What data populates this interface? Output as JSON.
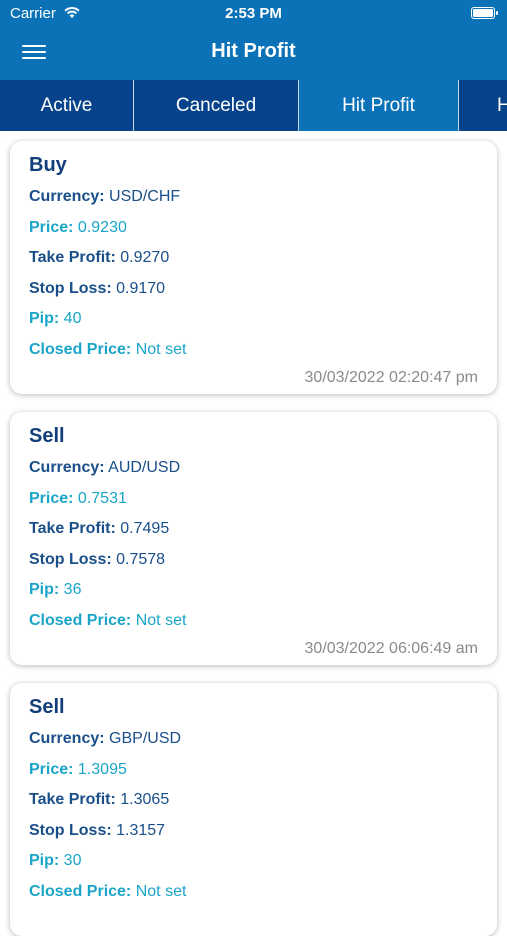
{
  "status_bar": {
    "carrier": "Carrier",
    "time": "2:53 PM"
  },
  "header": {
    "title": "Hit Profit"
  },
  "tabs": [
    {
      "label": "Active"
    },
    {
      "label": "Canceled"
    },
    {
      "label": "Hit Profit",
      "selected": true
    },
    {
      "label": "H"
    }
  ],
  "field_labels": {
    "currency": "Currency:",
    "price": "Price:",
    "take_profit": "Take Profit:",
    "stop_loss": "Stop Loss:",
    "pip": "Pip:",
    "closed_price": "Closed Price:"
  },
  "orders": [
    {
      "type": "Buy",
      "currency": "USD/CHF",
      "price": "0.9230",
      "take_profit": "0.9270",
      "stop_loss": "0.9170",
      "pip": "40",
      "closed_price": "Not set",
      "datetime": "30/03/2022 02:20:47 pm"
    },
    {
      "type": "Sell",
      "currency": "AUD/USD",
      "price": "0.7531",
      "take_profit": "0.7495",
      "stop_loss": "0.7578",
      "pip": "36",
      "closed_price": "Not set",
      "datetime": "30/03/2022 06:06:49 am"
    },
    {
      "type": "Sell",
      "currency": "GBP/USD",
      "price": "1.3095",
      "take_profit": "1.3065",
      "stop_loss": "1.3157",
      "pip": "30",
      "closed_price": "Not set",
      "datetime": ""
    }
  ],
  "colors": {
    "header": "#0b72b8",
    "tabs": "#06438a",
    "label_dark": "#1a4f8a",
    "label_cyan": "#1aa5c8",
    "date": "#8a8a8a"
  }
}
